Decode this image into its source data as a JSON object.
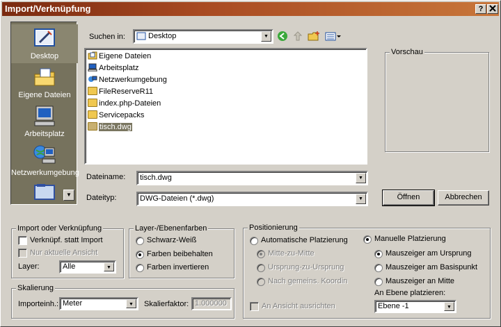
{
  "window": {
    "title": "Import/Verknüpfung",
    "help_btn": "?",
    "close_btn": "x"
  },
  "places": [
    {
      "label": "Desktop"
    },
    {
      "label": "Eigene Dateien"
    },
    {
      "label": "Arbeitsplatz"
    },
    {
      "label": "Netzwerkumgebung"
    },
    {
      "label": ""
    }
  ],
  "lookin": {
    "label": "Suchen in:",
    "value": "Desktop"
  },
  "files": [
    {
      "name": "Eigene Dateien",
      "icon": "docs-folder-icon"
    },
    {
      "name": "Arbeitsplatz",
      "icon": "computer-icon"
    },
    {
      "name": "Netzwerkumgebung",
      "icon": "network-icon"
    },
    {
      "name": "FileReserveR11",
      "icon": "folder-icon"
    },
    {
      "name": "index.php-Dateien",
      "icon": "folder-icon"
    },
    {
      "name": "Servicepacks",
      "icon": "folder-icon"
    },
    {
      "name": "tisch.dwg",
      "icon": "dwg-file-icon"
    }
  ],
  "preview": {
    "label": "Vorschau"
  },
  "filename": {
    "label": "Dateiname:",
    "value": "tisch.dwg"
  },
  "filetype": {
    "label": "Dateityp:",
    "value": "DWG-Dateien (*.dwg)"
  },
  "buttons": {
    "open": "Öffnen",
    "cancel": "Abbrechen"
  },
  "import_group": {
    "title": "Import oder Verknüpfung",
    "link_instead": "Verknüpf. statt Import",
    "only_view": "Nur aktuelle Ansicht",
    "layer_label": "Layer:",
    "layer_value": "Alle"
  },
  "layercolor_group": {
    "title": "Layer-/Ebenenfarben",
    "opt1": "Schwarz-Weiß",
    "opt2": "Farben beibehalten",
    "opt3": "Farben invertieren"
  },
  "scale_group": {
    "title": "Skalierung",
    "unit_label": "Importeinh.:",
    "unit_value": "Meter",
    "factor_label": "Skalierfaktor:",
    "factor_value": "1.000000"
  },
  "position_group": {
    "title": "Positionierung",
    "auto": "Automatische Platzierung",
    "auto_opt1": "Mitte-zu-Mitte",
    "auto_opt2": "Ursprung-zu-Ursprung",
    "auto_opt3": "Nach gemeins. Koordin",
    "align_view": "An Ansicht ausrichten",
    "manual": "Manuelle Platzierung",
    "man_opt1": "Mauszeiger am Ursprung",
    "man_opt2": "Mauszeiger am Basispunkt",
    "man_opt3": "Mauszeiger an Mitte",
    "plane_label": "An Ebene platzieren:",
    "plane_value": "Ebene -1"
  }
}
